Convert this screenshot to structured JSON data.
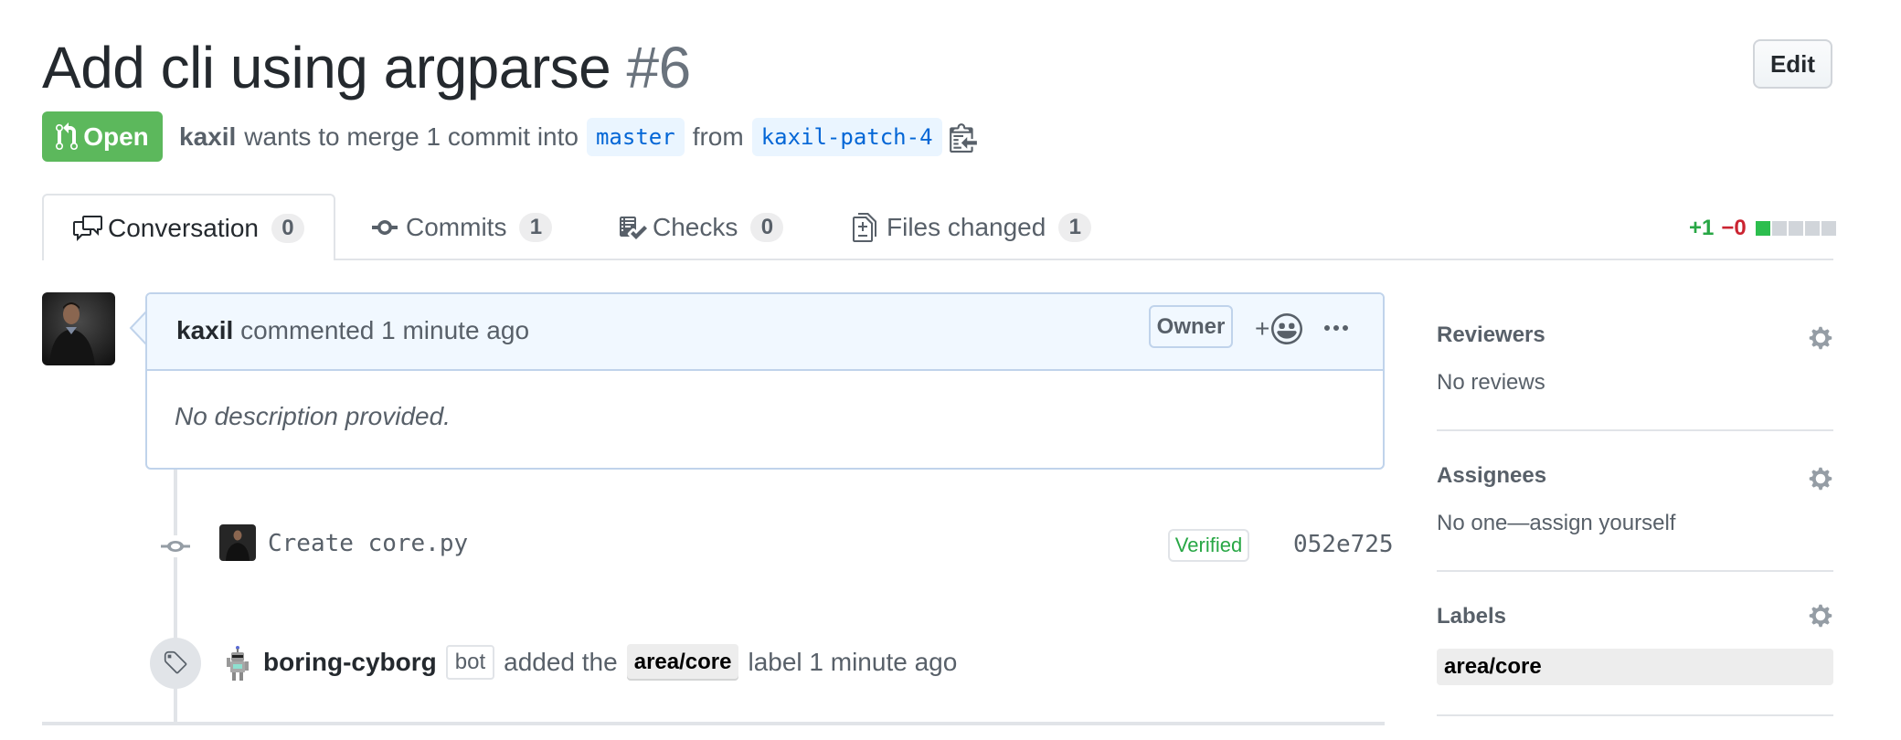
{
  "pr": {
    "title": "Add cli using argparse",
    "number": "#6",
    "edit_label": "Edit",
    "state": "Open",
    "author": "kaxil",
    "merge_text": "wants to merge 1 commit into",
    "base_branch": "master",
    "from_text": "from",
    "head_branch": "kaxil-patch-4"
  },
  "tabs": [
    {
      "label": "Conversation",
      "count": "0",
      "icon": "comment-discussion-icon",
      "selected": true
    },
    {
      "label": "Commits",
      "count": "1",
      "icon": "git-commit-icon"
    },
    {
      "label": "Checks",
      "count": "0",
      "icon": "checklist-icon"
    },
    {
      "label": "Files changed",
      "count": "1",
      "icon": "file-diff-icon"
    }
  ],
  "diffstat": {
    "additions": "+1",
    "deletions": "−0",
    "blocks": [
      "add",
      "neutral",
      "neutral",
      "neutral",
      "neutral"
    ]
  },
  "comment": {
    "author": "kaxil",
    "action": "commented 1 minute ago",
    "role_badge": "Owner",
    "reaction_plus": "+",
    "body": "No description provided."
  },
  "commit": {
    "message": "Create core.py",
    "verified": "Verified",
    "sha": "052e725"
  },
  "label_event": {
    "actor": "boring-cyborg",
    "bot_badge": "bot",
    "pre_text": "added the",
    "label": "area/core",
    "post_text": "label 1 minute ago"
  },
  "sidebar": {
    "reviewers": {
      "heading": "Reviewers",
      "value": "No reviews"
    },
    "assignees": {
      "heading": "Assignees",
      "value": "No one—assign yourself"
    },
    "labels": {
      "heading": "Labels",
      "items": [
        "area/core"
      ]
    }
  },
  "colors": {
    "open_green": "#5cb85c",
    "link_blue": "#0366d6",
    "additions": "#28a745",
    "deletions": "#cb2431",
    "comment_header_bg": "#f1f8ff"
  }
}
